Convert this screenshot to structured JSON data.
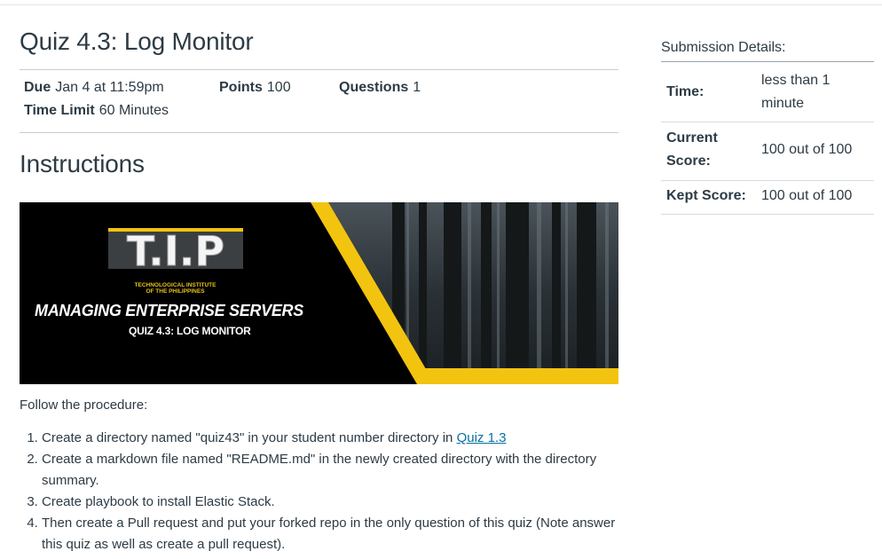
{
  "quiz": {
    "title": "Quiz 4.3: Log Monitor",
    "due_label": "Due",
    "due_value": "Jan 4 at 11:59pm",
    "points_label": "Points",
    "points_value": "100",
    "questions_label": "Questions",
    "questions_value": "1",
    "time_limit_label": "Time Limit",
    "time_limit_value": "60 Minutes"
  },
  "instructions": {
    "heading": "Instructions",
    "banner": {
      "logo_text": "T.I.P",
      "institute_line1": "TECHNOLOGICAL INSTITUTE",
      "institute_line2": "OF THE PHILIPPINES",
      "course": "MANAGING ENTERPRISE SERVERS",
      "subtitle": "QUIZ 4.3: LOG MONITOR",
      "accent_color": "#f2c40f"
    },
    "intro": "Follow the procedure:",
    "steps": [
      {
        "text": "Create a directory named \"quiz43\" in your student number directory in ",
        "link": "Quiz 1.3"
      },
      {
        "text": "Create a markdown file named \"README.md\" in the newly created directory with the directory summary."
      },
      {
        "text": "Create playbook to install Elastic Stack."
      },
      {
        "text": "Then create a Pull request and put your forked repo in the only question of this quiz (Note answer this quiz as well as create a pull request)."
      }
    ]
  },
  "submission": {
    "title": "Submission Details:",
    "rows": [
      {
        "label": "Time:",
        "value": "less than 1 minute"
      },
      {
        "label": "Current Score:",
        "value": "100 out of 100"
      },
      {
        "label": "Kept Score:",
        "value": "100 out of 100"
      }
    ]
  },
  "colors": {
    "text": "#2d3b45",
    "link": "#0770a3",
    "accent": "#f2c40f"
  }
}
